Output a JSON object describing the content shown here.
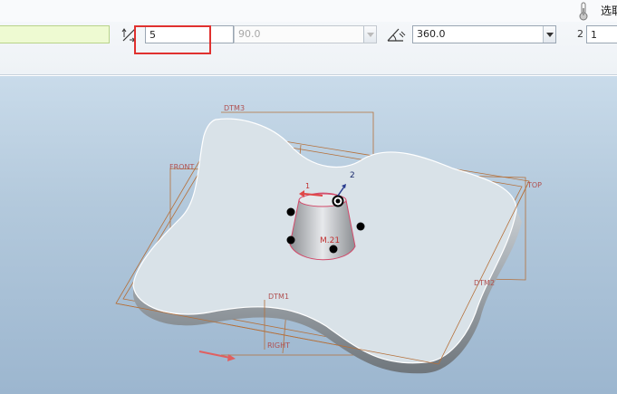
{
  "toolbar": {
    "depth_value": "5",
    "angle_value": "90.0",
    "revolve_angle": "360.0",
    "count_label": "2",
    "count_value": "1",
    "select_label": "选取"
  },
  "viewport": {
    "datums": {
      "dtm3": "DTM3",
      "front": "FRONT",
      "top": "TOP",
      "dtm1": "DTM1",
      "dtm2": "DTM2",
      "right": "RIGHT"
    },
    "dimension_text": "M.21",
    "handle_1": "1",
    "handle_2": "2"
  },
  "colors": {
    "highlight_box": "#e0312f",
    "datum": "#b5703a",
    "part": "#d9e2e8"
  }
}
